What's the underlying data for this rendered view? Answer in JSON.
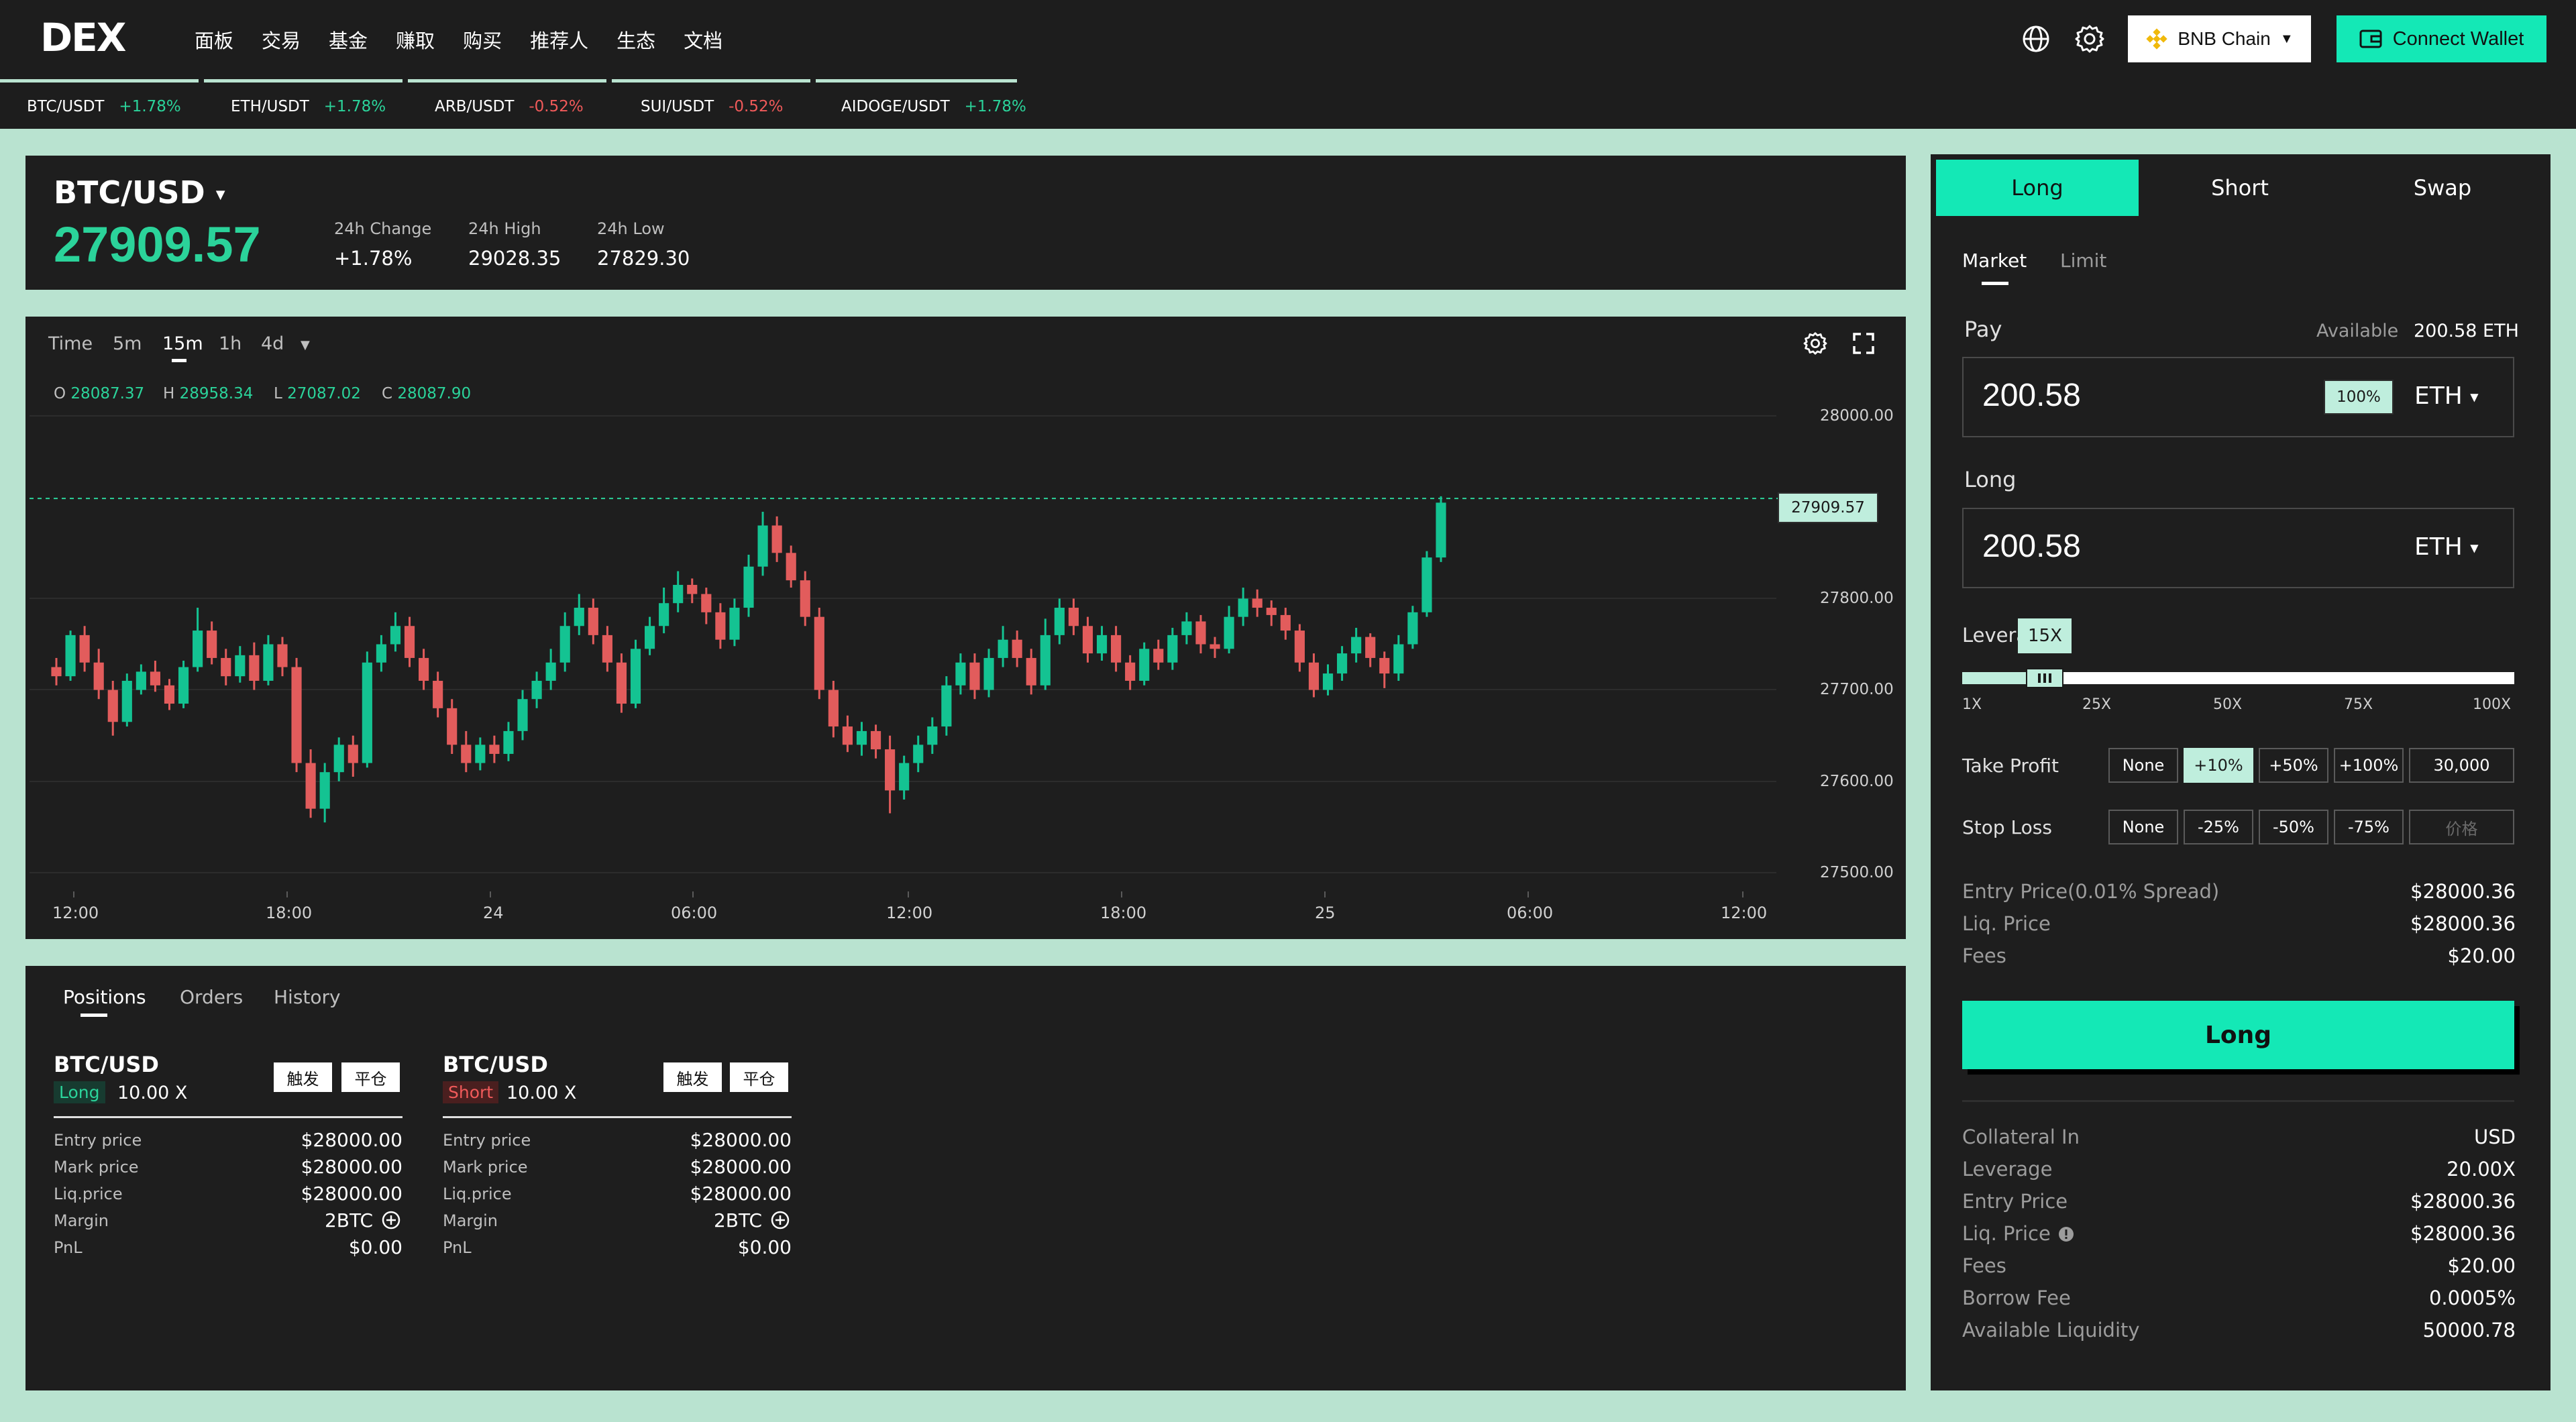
{
  "nav": {
    "logo": "DEX",
    "menu": [
      "面板",
      "交易",
      "基金",
      "赚取",
      "购买",
      "推荐人",
      "生态",
      "文档"
    ],
    "chain": "BNB Chain",
    "connect": "Connect Wallet"
  },
  "ticker": [
    {
      "pair": "BTC/USDT",
      "change": "+1.78%",
      "dir": "up"
    },
    {
      "pair": "ETH/USDT",
      "change": "+1.78%",
      "dir": "up"
    },
    {
      "pair": "ARB/USDT",
      "change": "-0.52%",
      "dir": "down"
    },
    {
      "pair": "SUI/USDT",
      "change": "-0.52%",
      "dir": "down"
    },
    {
      "pair": "AIDOGE/USDT",
      "change": "+1.78%",
      "dir": "up"
    }
  ],
  "market": {
    "pair": "BTC/USD",
    "price": "27909.57",
    "change_label": "24h Change",
    "change_value": "+1.78%",
    "high_label": "24h High",
    "high_value": "29028.35",
    "low_label": "24h Low",
    "low_value": "27829.30"
  },
  "chart": {
    "timeframes": [
      "Time",
      "5m",
      "15m",
      "1h",
      "4d"
    ],
    "active_timeframe": "15m",
    "ohlc": {
      "o": "28087.37",
      "h": "28958.34",
      "l": "27087.02",
      "c": "28087.90"
    },
    "current_price_label": "27909.57"
  },
  "chart_data": {
    "type": "candlestick",
    "y_ticks": [
      "28000.00",
      "27800.00",
      "27700.00",
      "27600.00",
      "27500.00"
    ],
    "x_ticks": [
      "12:00",
      "18:00",
      "24",
      "06:00",
      "12:00",
      "18:00",
      "25",
      "06:00",
      "12:00"
    ],
    "ylim": [
      27500,
      28000
    ],
    "current_price": 27909.57,
    "up_color": "#14c392",
    "down_color": "#e25c5c",
    "candles": [
      [
        27725,
        27715,
        27735,
        27705
      ],
      [
        27715,
        27760,
        27765,
        27710
      ],
      [
        27760,
        27730,
        27770,
        27720
      ],
      [
        27730,
        27700,
        27745,
        27690
      ],
      [
        27700,
        27665,
        27710,
        27650
      ],
      [
        27665,
        27710,
        27718,
        27660
      ],
      [
        27700,
        27720,
        27728,
        27695
      ],
      [
        27720,
        27705,
        27732,
        27698
      ],
      [
        27705,
        27685,
        27712,
        27678
      ],
      [
        27685,
        27725,
        27732,
        27680
      ],
      [
        27725,
        27765,
        27790,
        27720
      ],
      [
        27765,
        27735,
        27775,
        27728
      ],
      [
        27735,
        27715,
        27745,
        27705
      ],
      [
        27715,
        27738,
        27748,
        27708
      ],
      [
        27738,
        27710,
        27752,
        27700
      ],
      [
        27710,
        27750,
        27760,
        27705
      ],
      [
        27750,
        27725,
        27758,
        27715
      ],
      [
        27725,
        27620,
        27735,
        27610
      ],
      [
        27620,
        27570,
        27635,
        27560
      ],
      [
        27570,
        27610,
        27620,
        27555
      ],
      [
        27610,
        27640,
        27648,
        27600
      ],
      [
        27640,
        27620,
        27650,
        27605
      ],
      [
        27620,
        27730,
        27742,
        27615
      ],
      [
        27730,
        27750,
        27760,
        27720
      ],
      [
        27750,
        27770,
        27785,
        27742
      ],
      [
        27770,
        27735,
        27780,
        27725
      ],
      [
        27735,
        27710,
        27745,
        27700
      ],
      [
        27710,
        27680,
        27720,
        27670
      ],
      [
        27680,
        27640,
        27690,
        27630
      ],
      [
        27640,
        27620,
        27655,
        27610
      ],
      [
        27620,
        27640,
        27648,
        27612
      ],
      [
        27640,
        27630,
        27650,
        27620
      ],
      [
        27630,
        27655,
        27665,
        27622
      ],
      [
        27655,
        27690,
        27700,
        27645
      ],
      [
        27690,
        27710,
        27720,
        27680
      ],
      [
        27710,
        27730,
        27745,
        27700
      ],
      [
        27730,
        27770,
        27785,
        27720
      ],
      [
        27770,
        27790,
        27805,
        27760
      ],
      [
        27790,
        27760,
        27800,
        27750
      ],
      [
        27760,
        27730,
        27770,
        27720
      ],
      [
        27730,
        27685,
        27740,
        27675
      ],
      [
        27685,
        27745,
        27755,
        27680
      ],
      [
        27745,
        27770,
        27780,
        27738
      ],
      [
        27770,
        27795,
        27812,
        27762
      ],
      [
        27795,
        27815,
        27830,
        27785
      ],
      [
        27815,
        27805,
        27822,
        27795
      ],
      [
        27805,
        27785,
        27812,
        27772
      ],
      [
        27785,
        27755,
        27795,
        27745
      ],
      [
        27755,
        27790,
        27800,
        27748
      ],
      [
        27790,
        27835,
        27848,
        27780
      ],
      [
        27835,
        27880,
        27895,
        27825
      ],
      [
        27880,
        27850,
        27890,
        27840
      ],
      [
        27850,
        27820,
        27858,
        27812
      ],
      [
        27820,
        27780,
        27830,
        27770
      ],
      [
        27780,
        27700,
        27790,
        27690
      ],
      [
        27700,
        27660,
        27710,
        27648
      ],
      [
        27660,
        27640,
        27672,
        27632
      ],
      [
        27640,
        27655,
        27665,
        27628
      ],
      [
        27655,
        27635,
        27662,
        27625
      ],
      [
        27635,
        27590,
        27650,
        27565
      ],
      [
        27590,
        27620,
        27628,
        27580
      ],
      [
        27620,
        27640,
        27650,
        27610
      ],
      [
        27640,
        27660,
        27670,
        27630
      ],
      [
        27660,
        27705,
        27715,
        27650
      ],
      [
        27705,
        27730,
        27740,
        27695
      ],
      [
        27730,
        27700,
        27740,
        27690
      ],
      [
        27700,
        27735,
        27745,
        27692
      ],
      [
        27735,
        27755,
        27770,
        27725
      ],
      [
        27755,
        27735,
        27765,
        27725
      ],
      [
        27735,
        27705,
        27745,
        27695
      ],
      [
        27705,
        27760,
        27778,
        27700
      ],
      [
        27760,
        27790,
        27800,
        27750
      ],
      [
        27790,
        27770,
        27800,
        27760
      ],
      [
        27770,
        27740,
        27780,
        27730
      ],
      [
        27740,
        27760,
        27770,
        27732
      ],
      [
        27760,
        27730,
        27770,
        27720
      ],
      [
        27730,
        27710,
        27738,
        27700
      ],
      [
        27710,
        27745,
        27752,
        27705
      ],
      [
        27745,
        27730,
        27755,
        27722
      ],
      [
        27730,
        27760,
        27768,
        27722
      ],
      [
        27760,
        27775,
        27785,
        27750
      ],
      [
        27775,
        27750,
        27782,
        27740
      ],
      [
        27750,
        27745,
        27758,
        27735
      ],
      [
        27745,
        27780,
        27792,
        27740
      ],
      [
        27780,
        27800,
        27812,
        27770
      ],
      [
        27800,
        27790,
        27810,
        27780
      ],
      [
        27790,
        27782,
        27798,
        27770
      ],
      [
        27782,
        27765,
        27790,
        27755
      ],
      [
        27765,
        27730,
        27772,
        27720
      ],
      [
        27730,
        27700,
        27740,
        27692
      ],
      [
        27700,
        27718,
        27728,
        27694
      ],
      [
        27718,
        27740,
        27748,
        27710
      ],
      [
        27740,
        27758,
        27768,
        27730
      ],
      [
        27758,
        27735,
        27762,
        27725
      ],
      [
        27735,
        27718,
        27742,
        27702
      ],
      [
        27718,
        27750,
        27760,
        27710
      ],
      [
        27750,
        27785,
        27792,
        27745
      ],
      [
        27785,
        27845,
        27852,
        27780
      ],
      [
        27845,
        27905,
        27912,
        27840
      ]
    ]
  },
  "positions": {
    "tabs": [
      "Positions",
      "Orders",
      "History"
    ],
    "btn_trigger": "触发",
    "btn_close": "平仓",
    "labels": [
      "Entry price",
      "Mark price",
      "Liq.price",
      "Margin",
      "PnL"
    ],
    "cards": [
      {
        "pair": "BTC/USD",
        "side": "Long",
        "leverage": "10.00 X",
        "values": [
          "$28000.00",
          "$28000.00",
          "$28000.00",
          "2BTC",
          "$0.00"
        ]
      },
      {
        "pair": "BTC/USD",
        "side": "Short",
        "leverage": "10.00 X",
        "values": [
          "$28000.00",
          "$28000.00",
          "$28000.00",
          "2BTC",
          "$0.00"
        ]
      }
    ]
  },
  "trade": {
    "tabs": [
      "Long",
      "Short",
      "Swap"
    ],
    "order_types": [
      "Market",
      "Limit"
    ],
    "pay_label": "Pay",
    "available_label": "Available",
    "available_value": "200.58 ETH",
    "pay_value": "200.58",
    "pay_max": "100%",
    "pay_token": "ETH",
    "long_label": "Long",
    "long_value": "200.58",
    "long_token": "ETH",
    "leverage_label": "Leverage",
    "leverage_value": "15X",
    "leverage_fraction": 0.15,
    "leverage_marks": [
      "1X",
      "25X",
      "50X",
      "75X",
      "100X"
    ],
    "tp_label": "Take Profit",
    "tp_options": [
      "None",
      "+10%",
      "+50%",
      "+100%",
      "30,000"
    ],
    "sl_label": "Stop Loss",
    "sl_options": [
      "None",
      "-25%",
      "-50%",
      "-75%"
    ],
    "sl_placeholder": "价格",
    "entry_rows": [
      {
        "label": "Entry Price(0.01% Spread)",
        "value": "$28000.36"
      },
      {
        "label": "Liq. Price",
        "value": "$28000.36"
      },
      {
        "label": "Fees",
        "value": "$20.00"
      }
    ],
    "submit": "Long",
    "summary_rows": [
      {
        "label": "Collateral In",
        "value": "USD"
      },
      {
        "label": "Leverage",
        "value": "20.00X"
      },
      {
        "label": "Entry Price",
        "value": "$28000.36"
      },
      {
        "label": "Liq. Price",
        "value": "$28000.36"
      },
      {
        "label": "Fees",
        "value": "$20.00"
      },
      {
        "label": "Borrow Fee",
        "value": "0.0005%"
      },
      {
        "label": "Available Liquidity",
        "value": "50000.78"
      }
    ]
  }
}
